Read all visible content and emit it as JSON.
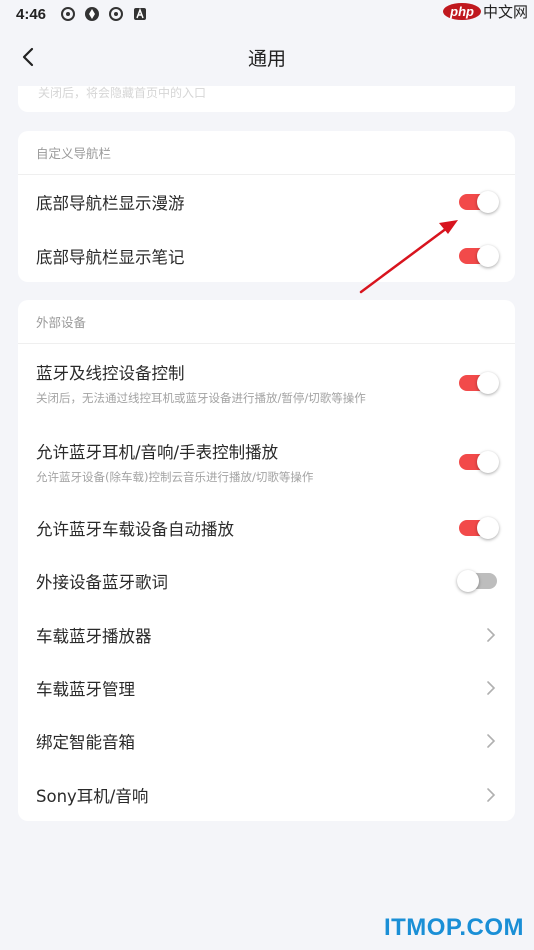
{
  "status_bar": {
    "time": "4:46"
  },
  "watermark_top": {
    "badge": "php",
    "text": "中文网"
  },
  "header": {
    "title": "通用"
  },
  "top_card": {
    "faded_text": "关闭后，将会隐藏首页中的入口"
  },
  "nav_section": {
    "header": "自定义导航栏",
    "rows": [
      {
        "title": "底部导航栏显示漫游",
        "toggle": "on"
      },
      {
        "title": "底部导航栏显示笔记",
        "toggle": "on"
      }
    ]
  },
  "device_section": {
    "header": "外部设备",
    "rows": [
      {
        "title": "蓝牙及线控设备控制",
        "subtitle": "关闭后，无法通过线控耳机或蓝牙设备进行播放/暂停/切歌等操作",
        "toggle": "on"
      },
      {
        "title": "允许蓝牙耳机/音响/手表控制播放",
        "subtitle": "允许蓝牙设备(除车载)控制云音乐进行播放/切歌等操作",
        "toggle": "on"
      },
      {
        "title": "允许蓝牙车载设备自动播放",
        "toggle": "on"
      },
      {
        "title": "外接设备蓝牙歌词",
        "toggle": "off"
      },
      {
        "title": "车载蓝牙播放器",
        "action": "chevron"
      },
      {
        "title": "车载蓝牙管理",
        "action": "chevron"
      },
      {
        "title": "绑定智能音箱",
        "action": "chevron"
      },
      {
        "title": "Sony耳机/音响",
        "action": "chevron"
      }
    ]
  },
  "watermark_bottom": {
    "text": "ITMOP.COM"
  },
  "colors": {
    "toggle_on": "#f24a4a",
    "toggle_off": "#bdbdbd",
    "background": "#f4f5f9",
    "arrow": "#d8141e",
    "watermark": "#1a8fd6"
  }
}
